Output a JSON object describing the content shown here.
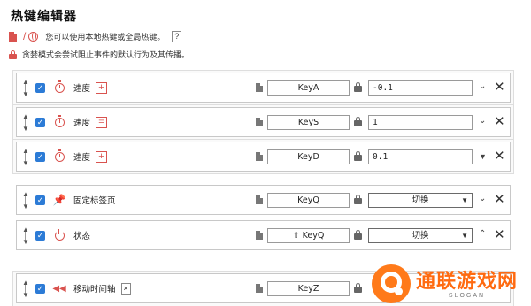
{
  "title": "热键编辑器",
  "info": {
    "line1": "您可以使用本地热键或全局热键。",
    "help": "?",
    "line2": "贪婪模式会尝试阻止事件的默认行为及其传播。"
  },
  "rows": [
    {
      "label": "速度",
      "op": "+",
      "key": "KeyA",
      "value": "-0.1",
      "chevron": "down",
      "icon": "timer-icon"
    },
    {
      "label": "速度",
      "op": "=",
      "key": "KeyS",
      "value": "1",
      "chevron": "down",
      "icon": "timer-icon"
    },
    {
      "label": "速度",
      "op": "+",
      "key": "KeyD",
      "value": "0.1",
      "chevron": "down-filled",
      "icon": "timer-icon"
    },
    {
      "label": "固定标签页",
      "key": "KeyQ",
      "select": "切换",
      "chevron": "down",
      "icon": "pin-icon"
    },
    {
      "label": "状态",
      "key": "⇧ KeyQ",
      "select": "切换",
      "chevron": "up",
      "icon": "power-icon"
    },
    {
      "label": "移动时间轴",
      "op": "×",
      "key": "KeyZ",
      "icon": "rewind-icon"
    }
  ],
  "colors": {
    "accent": "#d9534f",
    "checkbox": "#2c7bd6"
  },
  "watermark": {
    "main": "通联游戏网",
    "sub": "SLOGAN"
  }
}
